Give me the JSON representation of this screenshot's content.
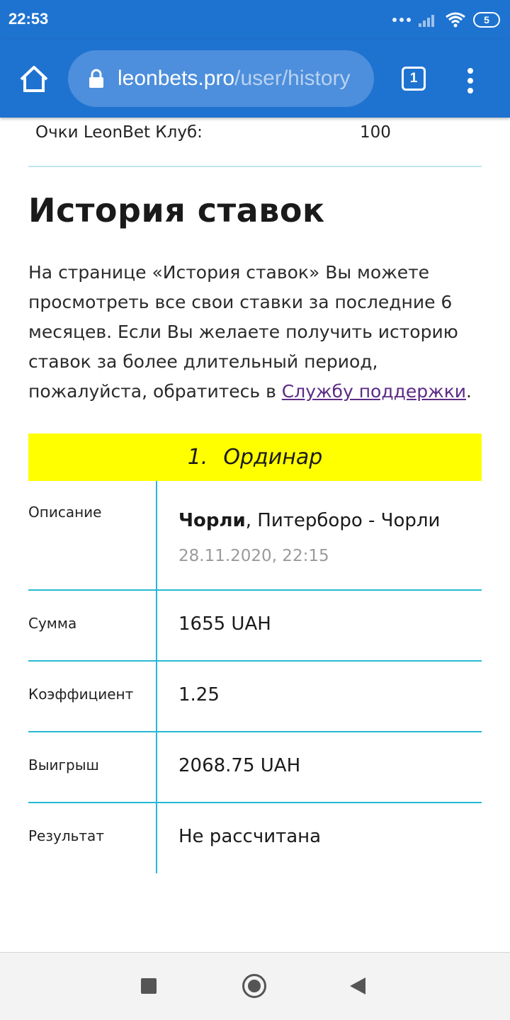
{
  "status_bar": {
    "time": "22:53",
    "battery": "5"
  },
  "browser": {
    "url_host": "leonbets.pro",
    "url_path": "/user/history",
    "tab_count": "1"
  },
  "club": {
    "label": "Очки LeonBet Клуб:",
    "value": "100"
  },
  "page": {
    "title": "История ставок",
    "intro_text": "На странице «История ставок» Вы можете просмотреть все свои ставки за последние 6 месяцев. Если Вы желаете получить историю ставок за более длительный период, пожалуйста, обратитесь в ",
    "support_link": "Службу поддержки",
    "intro_end": "."
  },
  "bet": {
    "number": "1.",
    "type": "Ординар",
    "rows": {
      "description_label": "Описание",
      "team": "Чорли",
      "event": ", Питерборо - Чорли",
      "date": "28.11.2020, 22:15",
      "amount_label": "Сумма",
      "amount": "1655 UAH",
      "coef_label": "Коэффициент",
      "coef": "1.25",
      "win_label": "Выигрыш",
      "win": "2068.75 UAH",
      "result_label": "Результат",
      "result": "Не рассчитана"
    }
  },
  "colors": {
    "toolbar": "#1f73d0",
    "header_highlight": "#ffff00",
    "table_lines": "#27b8d4",
    "link": "#5b2a86"
  }
}
